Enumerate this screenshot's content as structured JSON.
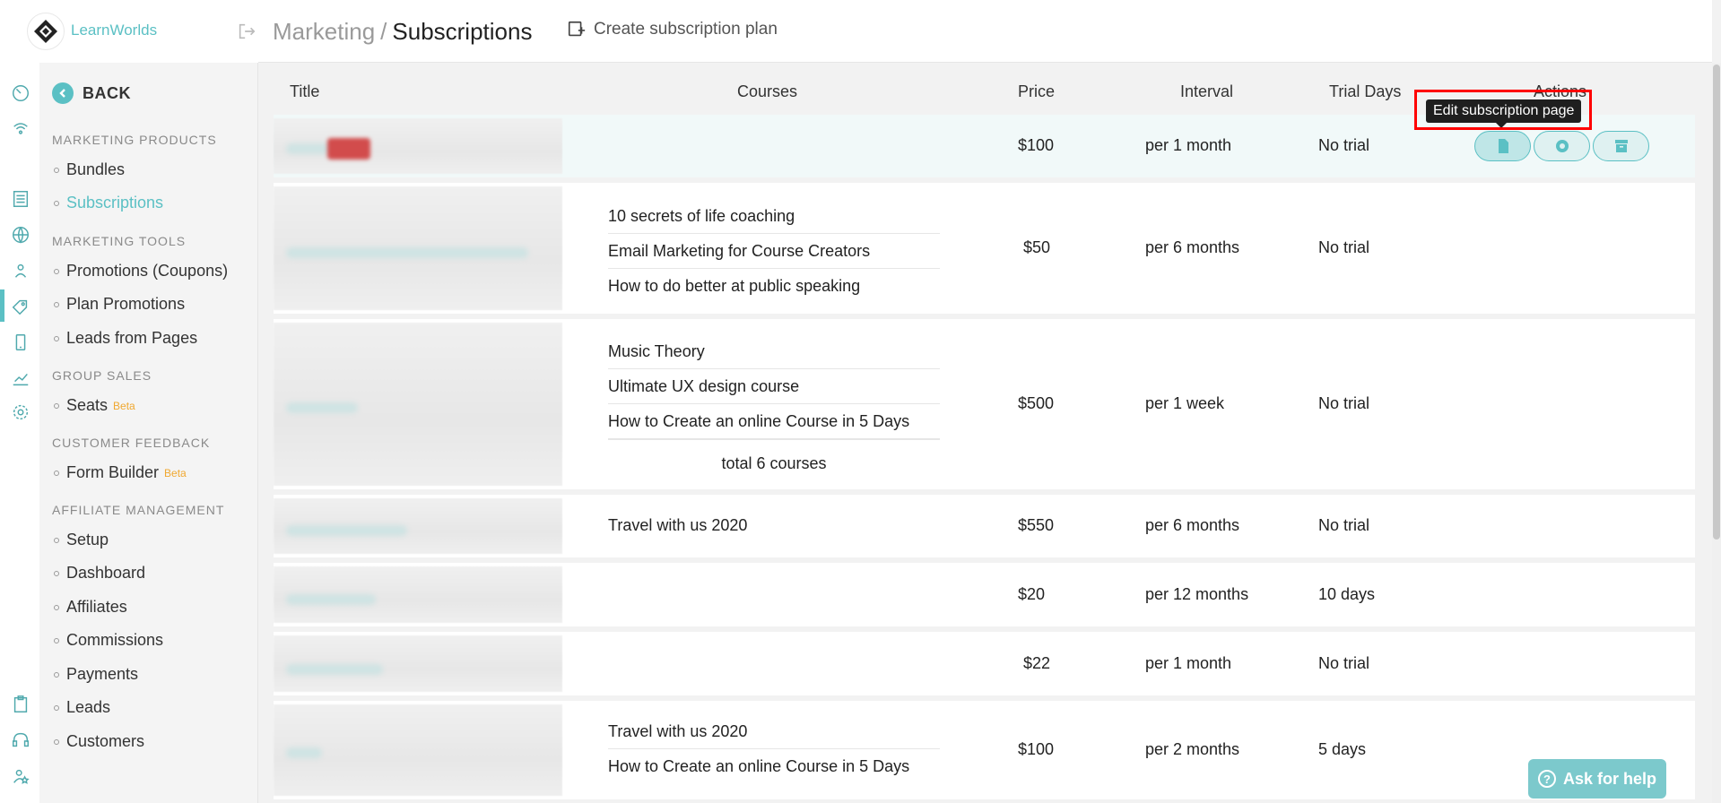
{
  "app": {
    "logo_text": "LearnWorlds"
  },
  "sidebar": {
    "back_label": "BACK",
    "sections": [
      {
        "title": "MARKETING PRODUCTS",
        "items": [
          {
            "label": "Bundles"
          },
          {
            "label": "Subscriptions",
            "active": true
          }
        ]
      },
      {
        "title": "MARKETING TOOLS",
        "items": [
          {
            "label": "Promotions (Coupons)"
          },
          {
            "label": "Plan Promotions"
          },
          {
            "label": "Leads from Pages"
          }
        ]
      },
      {
        "title": "GROUP SALES",
        "items": [
          {
            "label": "Seats",
            "badge": "Beta"
          }
        ]
      },
      {
        "title": "CUSTOMER FEEDBACK",
        "items": [
          {
            "label": "Form Builder",
            "badge": "Beta"
          }
        ]
      },
      {
        "title": "AFFILIATE MANAGEMENT",
        "items": [
          {
            "label": "Setup"
          },
          {
            "label": "Dashboard"
          },
          {
            "label": "Affiliates"
          },
          {
            "label": "Commissions"
          },
          {
            "label": "Payments"
          },
          {
            "label": "Leads"
          },
          {
            "label": "Customers"
          }
        ]
      }
    ]
  },
  "header": {
    "breadcrumb_parent": "Marketing",
    "breadcrumb_separator": "/",
    "breadcrumb_current": "Subscriptions",
    "create_label": "Create subscription plan"
  },
  "table": {
    "columns": {
      "title": "Title",
      "courses": "Courses",
      "price": "Price",
      "interval": "Interval",
      "trial": "Trial Days",
      "actions": "Actions"
    },
    "rows": [
      {
        "courses": [],
        "price": "$100",
        "interval": "per 1 month",
        "trial": "No trial"
      },
      {
        "courses": [
          "10 secrets of life coaching",
          "Email Marketing for Course Creators",
          "How to do better at public speaking"
        ],
        "price": "$50",
        "interval": "per 6 months",
        "trial": "No trial"
      },
      {
        "courses": [
          "Music Theory",
          "Ultimate UX design course",
          "How to Create an online Course in 5 Days"
        ],
        "total": "total 6 courses",
        "price": "$500",
        "interval": "per 1 week",
        "trial": "No trial"
      },
      {
        "courses": [
          "Travel with us 2020"
        ],
        "price": "$550",
        "interval": "per 6 months",
        "trial": "No trial"
      },
      {
        "courses": [],
        "price": "$20",
        "interval": "per 12 months",
        "trial": "10 days"
      },
      {
        "courses": [],
        "price": "$22",
        "interval": "per 1 month",
        "trial": "No trial"
      },
      {
        "courses": [
          "Travel with us 2020",
          "How to Create an online Course in 5 Days"
        ],
        "price": "$100",
        "interval": "per 2 months",
        "trial": "5 days"
      }
    ]
  },
  "tooltip": {
    "text": "Edit subscription page"
  },
  "help": {
    "label": "Ask for help",
    "icon": "?"
  },
  "icons": {
    "rail": [
      "dashboard-icon",
      "broadcast-icon",
      "list-icon",
      "globe-icon",
      "users-icon",
      "tag-icon",
      "mobile-icon",
      "chart-icon",
      "gear-icon",
      "clipboard-icon",
      "headset-icon",
      "star-users-icon"
    ],
    "actions": [
      "document-icon",
      "gear-icon",
      "archive-icon"
    ]
  },
  "colors": {
    "accent": "#5bc0c4",
    "beta": "#f0a830",
    "highlight": "#ff0000"
  }
}
